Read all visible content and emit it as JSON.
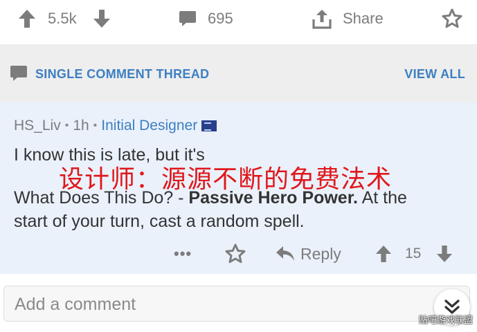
{
  "post_actions": {
    "score": "5.5k",
    "comment_count": "695",
    "share_label": "Share"
  },
  "thread": {
    "title": "SINGLE COMMENT THREAD",
    "view_all_label": "VIEW ALL"
  },
  "comment": {
    "author": "HS_Liv",
    "age": "1h",
    "flair": "Initial Designer",
    "body_line1": "I know this is late, but it's",
    "body_line2_prefix": "What Does This Do? - ",
    "body_line2_strong": "Passive Hero Power.",
    "body_line2_suffix": " At the",
    "body_line3": "start of your turn, cast a random spell.",
    "overlay_caption": "设计师：源源不断的免费法术",
    "more_label": "•••",
    "reply_label": "Reply",
    "score": "15"
  },
  "composer": {
    "placeholder": "Add a comment"
  },
  "watermark": "贴吧游戏联盟",
  "colors": {
    "accent": "#3d7fc2",
    "icon_gray": "#7c7c7c",
    "header_bg": "#eeeeee",
    "comment_bg": "#eaf1fb",
    "overlay_red": "#e0171b"
  }
}
